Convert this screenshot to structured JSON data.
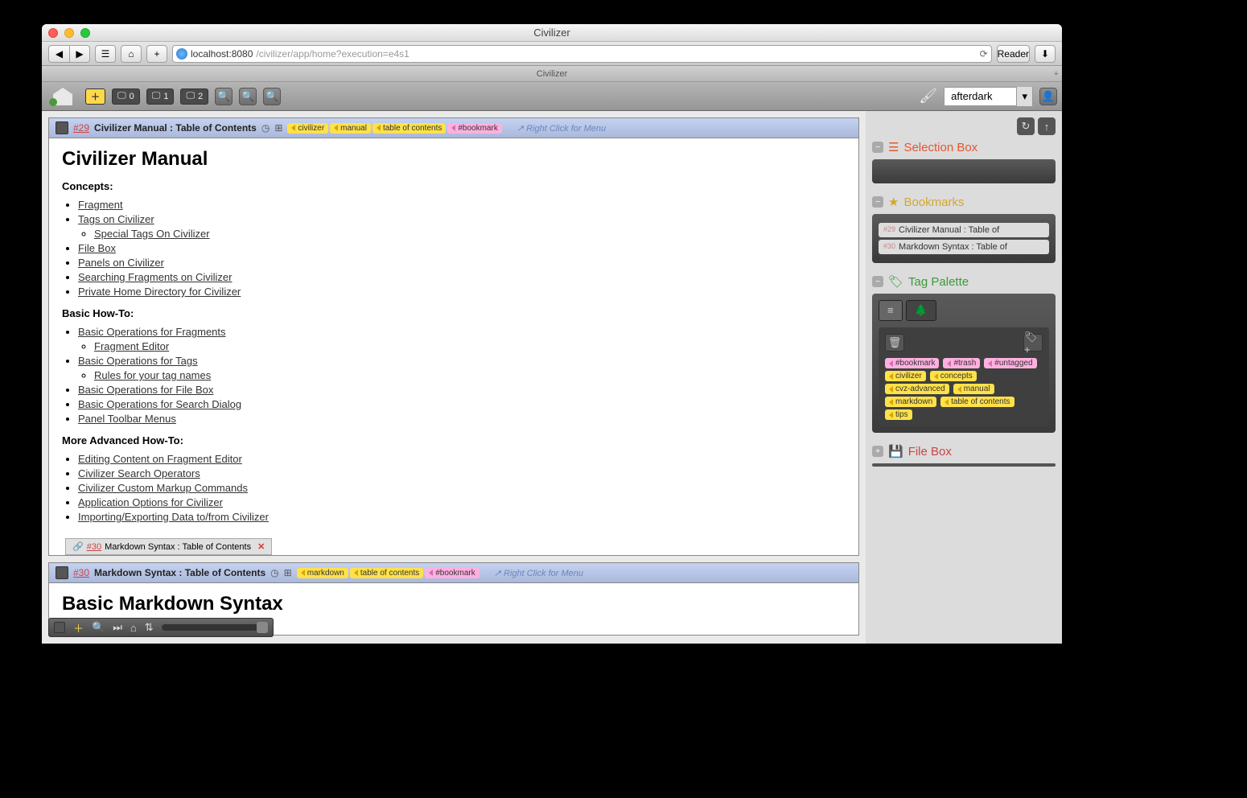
{
  "window": {
    "title": "Civilizer"
  },
  "browser": {
    "url_host": "localhost:8080",
    "url_path": "/civilizer/app/home?execution=e4s1",
    "reader": "Reader",
    "tab_title": "Civilizer"
  },
  "app_toolbar": {
    "panel0": "0",
    "panel1": "1",
    "panel2": "2",
    "theme": "afterdark"
  },
  "fragments": [
    {
      "id_label": "#29",
      "title": "Civilizer Manual : Table of Contents",
      "tags": [
        {
          "text": "civilizer",
          "pink": false
        },
        {
          "text": "manual",
          "pink": false
        },
        {
          "text": "table of contents",
          "pink": false
        },
        {
          "text": "#bookmark",
          "pink": true
        }
      ],
      "hint": "Right Click for Menu",
      "body_title": "Civilizer Manual",
      "sections": [
        {
          "heading": "Concepts:",
          "links": [
            {
              "text": "Fragment"
            },
            {
              "text": "Tags on Civilizer",
              "sub": [
                {
                  "text": "Special Tags On Civilizer"
                }
              ]
            },
            {
              "text": "File Box"
            },
            {
              "text": "Panels on Civilizer"
            },
            {
              "text": "Searching Fragments on Civilizer"
            },
            {
              "text": "Private Home Directory for Civilizer"
            }
          ]
        },
        {
          "heading": "Basic How-To:",
          "links": [
            {
              "text": "Basic Operations for Fragments",
              "sub": [
                {
                  "text": "Fragment Editor"
                }
              ]
            },
            {
              "text": "Basic Operations for Tags",
              "sub": [
                {
                  "text": "Rules for your tag names"
                }
              ]
            },
            {
              "text": "Basic Operations for File Box"
            },
            {
              "text": "Basic Operations for Search Dialog"
            },
            {
              "text": "Panel Toolbar Menus"
            }
          ]
        },
        {
          "heading": "More Advanced How-To:",
          "links": [
            {
              "text": "Editing Content on Fragment Editor"
            },
            {
              "text": "Civilizer Search Operators"
            },
            {
              "text": "Civilizer Custom Markup Commands"
            },
            {
              "text": "Application Options for Civilizer"
            },
            {
              "text": "Importing/Exporting Data to/from Civilizer"
            }
          ]
        }
      ],
      "related": {
        "id": "#30",
        "title": "Markdown Syntax : Table of Contents"
      }
    },
    {
      "id_label": "#30",
      "title": "Markdown Syntax : Table of Contents",
      "tags": [
        {
          "text": "markdown",
          "pink": false
        },
        {
          "text": "table of contents",
          "pink": false
        },
        {
          "text": "#bookmark",
          "pink": true
        }
      ],
      "hint": "Right Click for Menu",
      "body_title": "Basic Markdown Syntax"
    }
  ],
  "sidebar": {
    "selection": {
      "title": "Selection Box"
    },
    "bookmarks": {
      "title": "Bookmarks",
      "items": [
        {
          "id": "#29",
          "title": "Civilizer Manual : Table of"
        },
        {
          "id": "#30",
          "title": "Markdown Syntax : Table of"
        }
      ]
    },
    "tag_palette": {
      "title": "Tag Palette",
      "tags": [
        {
          "text": "#bookmark",
          "pink": true
        },
        {
          "text": "#trash",
          "pink": true
        },
        {
          "text": "#untagged",
          "pink": true
        },
        {
          "text": "civilizer",
          "pink": false
        },
        {
          "text": "concepts",
          "pink": false
        },
        {
          "text": "cvz-advanced",
          "pink": false
        },
        {
          "text": "manual",
          "pink": false
        },
        {
          "text": "markdown",
          "pink": false
        },
        {
          "text": "table of contents",
          "pink": false
        },
        {
          "text": "tips",
          "pink": false
        }
      ]
    },
    "filebox": {
      "title": "File Box"
    }
  }
}
